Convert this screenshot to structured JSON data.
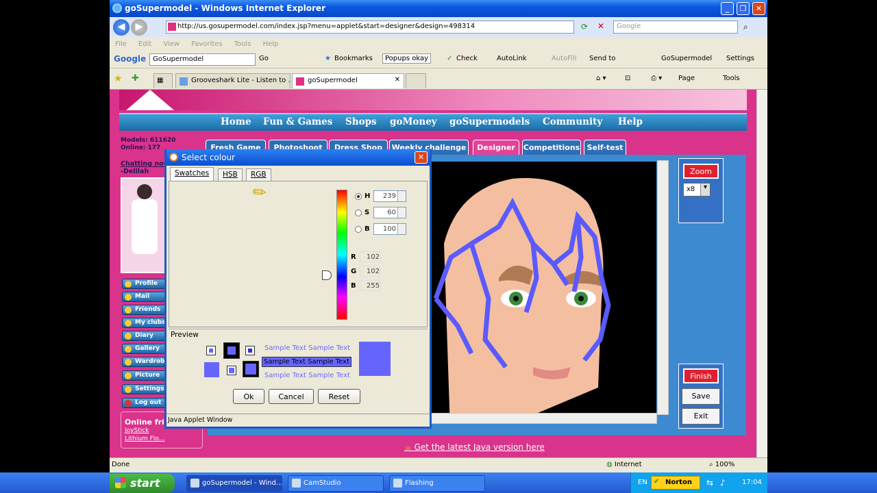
{
  "window": {
    "title": "goSupermodel - Windows Internet Explorer"
  },
  "address": {
    "url": "http://us.gosupermodel.com/index.jsp?menu=applet&start=designer&design=498314",
    "search_placeholder": "Google"
  },
  "menu": [
    "File",
    "Edit",
    "View",
    "Favorites",
    "Tools",
    "Help"
  ],
  "google_toolbar": {
    "logo": "Google",
    "search_value": "GoSupermodel",
    "go": "Go",
    "bookmarks": "Bookmarks",
    "popups": "Popups okay",
    "check": "Check",
    "autolink": "AutoLink",
    "autofill": "AutoFill",
    "sendto": "Send to",
    "gosupermodel": "GoSupermodel",
    "settings": "Settings"
  },
  "tabs": [
    {
      "label": "Grooveshark Lite - Listen to ..."
    },
    {
      "label": "goSupermodel"
    }
  ],
  "tab_tools": {
    "page": "Page",
    "tools": "Tools"
  },
  "site_nav": [
    "Home",
    "Fun & Games",
    "Shops",
    "goMoney",
    "goSupermodels",
    "Community",
    "Help"
  ],
  "stats": {
    "models": "Models: 611620",
    "online": "Online: 177"
  },
  "chatting": {
    "line1": "Chatting now",
    "line2": "-Delilah"
  },
  "side_menu": [
    "Profile",
    "Mail",
    "Friends",
    "My clubs",
    "Diary",
    "Gallery",
    "Wardrobe",
    "Picture",
    "Settings",
    "Log out"
  ],
  "online_friends": {
    "title": "Online frie",
    "items": [
      "JoyStick",
      "Lithium Flo..."
    ]
  },
  "game_tabs": [
    {
      "label": "Fresh Game"
    },
    {
      "label": "Photoshoot"
    },
    {
      "label": "Dress Shop"
    },
    {
      "label": "Weekly challenge"
    },
    {
      "label": "Designer"
    },
    {
      "label": "Competitions"
    },
    {
      "label": "Self-test"
    }
  ],
  "editor": {
    "zoom": "Zoom",
    "zoom_level": "x8",
    "finish": "Finish",
    "save": "Save",
    "exit": "Exit"
  },
  "java_link": "Get the latest Java version here",
  "dialog": {
    "title": "Select colour",
    "tabs": [
      "Swatches",
      "HSB",
      "RGB"
    ],
    "hsb": {
      "h_label": "H",
      "h": "239",
      "s_label": "S",
      "s": "60",
      "b_label": "B",
      "b": "100"
    },
    "rgb": {
      "r_label": "R",
      "r": "102",
      "g_label": "G",
      "g": "102",
      "b_label": "B",
      "b": "255"
    },
    "preview_label": "Preview",
    "sample": "Sample Text",
    "ok": "Ok",
    "cancel": "Cancel",
    "reset": "Reset",
    "status": "Java Applet Window",
    "color": "#6666ff"
  },
  "statusbar": {
    "done": "Done",
    "zone": "Internet",
    "zoom": "100%"
  },
  "taskbar": {
    "start": "start",
    "tasks": [
      "goSupermodel - Wind...",
      "CamStudio",
      "Flashing"
    ],
    "lang": "EN",
    "norton": "Norton",
    "time": "17:04"
  }
}
